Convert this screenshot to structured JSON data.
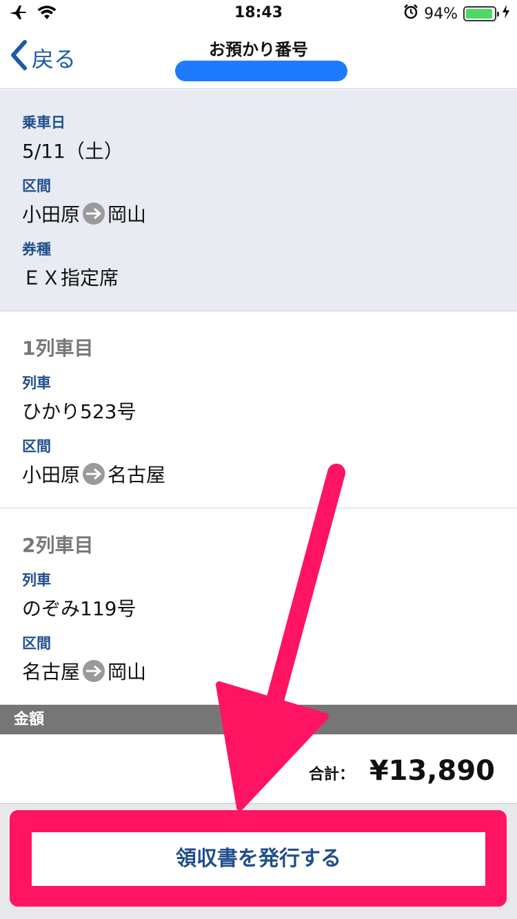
{
  "status_bar": {
    "time": "18:43",
    "battery_percent": "94%",
    "battery_level": 0.94,
    "icons": [
      "airplane-icon",
      "wifi-icon",
      "alarm-icon",
      "battery-icon",
      "charging-icon"
    ]
  },
  "nav": {
    "back_label": "戻る",
    "title": "お預かり番号"
  },
  "summary": {
    "date_label": "乗車日",
    "date_value": "5/11（土）",
    "section_label": "区間",
    "from": "小田原",
    "to": "岡山",
    "ticket_label": "券種",
    "ticket_value": "ＥＸ指定席"
  },
  "trains": [
    {
      "title": "1列車目",
      "train_label": "列車",
      "train_value": "ひかり523号",
      "section_label": "区間",
      "from": "小田原",
      "to": "名古屋"
    },
    {
      "title": "2列車目",
      "train_label": "列車",
      "train_value": "のぞみ119号",
      "section_label": "区間",
      "from": "名古屋",
      "to": "岡山"
    }
  ],
  "amount": {
    "header": "金額",
    "total_label": "合計：",
    "total_value": "¥13,890"
  },
  "footer": {
    "receipt_button": "領収書を発行する"
  },
  "colors": {
    "accent": "#1f4e8c",
    "pill": "#1e7bfd",
    "highlight": "#ff1461",
    "summary_bg": "#e8ebf2"
  }
}
